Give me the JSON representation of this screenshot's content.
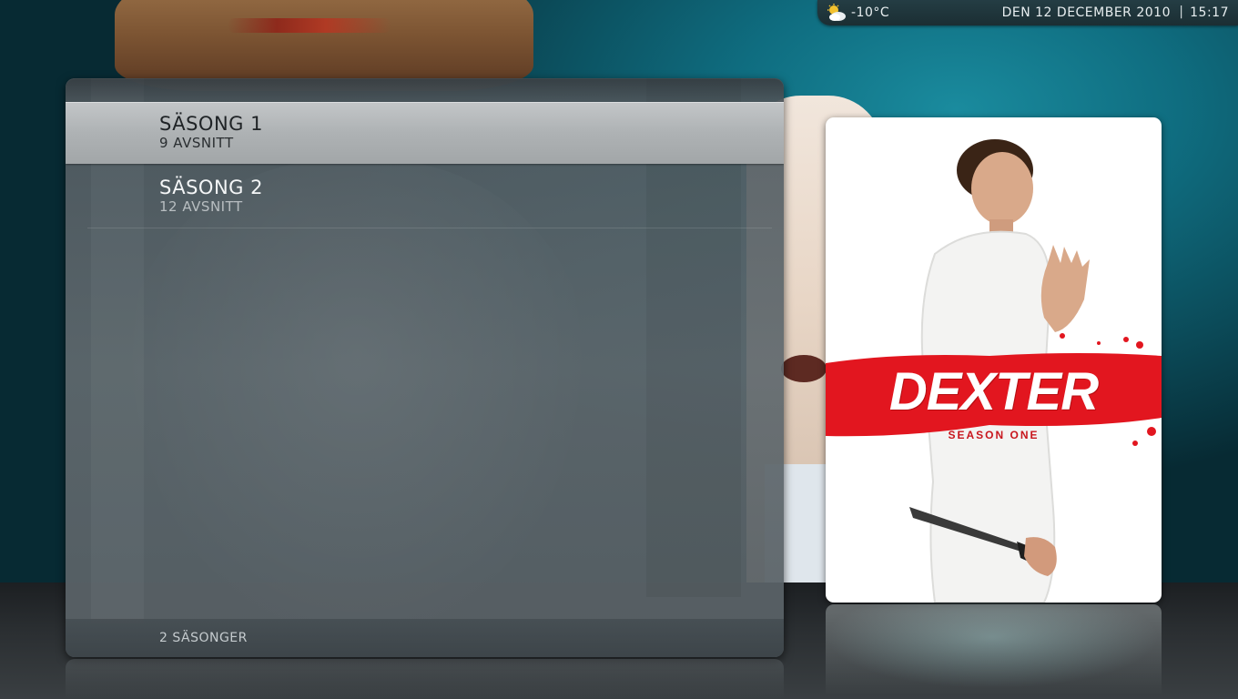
{
  "status_bar": {
    "weather_icon": "partly-cloudy-icon",
    "temperature": "-10°C",
    "date": "DEN 12 DECEMBER 2010",
    "separator": "|",
    "time": "15:17"
  },
  "seasons": {
    "items": [
      {
        "title": "SÄSONG 1",
        "subtitle": "9 AVSNITT",
        "selected": true
      },
      {
        "title": "SÄSONG 2",
        "subtitle": "12 AVSNITT",
        "selected": false
      }
    ],
    "footer": "2 SÄSONGER"
  },
  "poster": {
    "title": "DEXTER",
    "subtitle": "SEASON ONE"
  },
  "colors": {
    "background_teal": "#0f6d80",
    "panel": "#5f686d",
    "selected_row": "#b0b4b6",
    "poster_red": "#e2161f"
  }
}
